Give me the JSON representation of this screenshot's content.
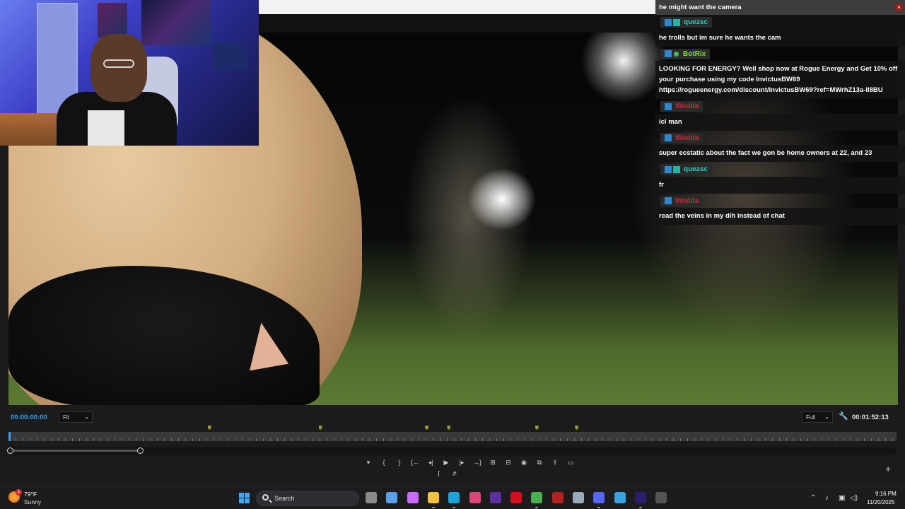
{
  "chat": {
    "top_message": "he might want the camera",
    "close_label": "×",
    "messages": [
      {
        "user": "quezsc",
        "user_color": "#23d3c4",
        "badge": "teal",
        "text": "he trolls but im sure he wants the cam"
      },
      {
        "user": "BotRix",
        "user_color": "#7fe12d",
        "badge": "green",
        "text": "LOOKING FOR ENERGY? Well shop now at Rogue Energy and Get 10% off your purchase using my code InvictusBW69 https://rogueenergy.com/discount/InvictusBW69?ref=MWrhZ13a-Il8BU"
      },
      {
        "user": "Wodda",
        "user_color": "#d0243b",
        "badge": "blue",
        "text": "icl man"
      },
      {
        "user": "Wodda",
        "user_color": "#d0243b",
        "badge": "blue",
        "text": "super ecstatic about the fact we gon be home owners at 22, and 23"
      },
      {
        "user": "quezsc",
        "user_color": "#23d3c4",
        "badge": "teal",
        "text": "fr"
      },
      {
        "user": "Wodda",
        "user_color": "#d0243b",
        "badge": "blue",
        "text": "read the veins in my dih instead of chat"
      }
    ]
  },
  "monitor": {
    "timecode_current": "00:00:00:00",
    "zoom_select": "Fit",
    "quality_select": "Full",
    "timecode_duration": "00:01:52:13",
    "playhead_fraction": 0,
    "chevron": "⌄"
  },
  "transport": {
    "buttons": [
      {
        "name": "add-marker-icon",
        "glyph": "▾"
      },
      {
        "name": "mark-in-icon",
        "glyph": "{"
      },
      {
        "name": "mark-out-icon",
        "glyph": "}"
      },
      {
        "name": "go-to-in-icon",
        "glyph": "{←"
      },
      {
        "name": "step-back-icon",
        "glyph": "◂|"
      },
      {
        "name": "play-icon",
        "glyph": "▶"
      },
      {
        "name": "step-forward-icon",
        "glyph": "|▸"
      },
      {
        "name": "go-to-out-icon",
        "glyph": "→}"
      },
      {
        "name": "lift-icon",
        "glyph": "⊞"
      },
      {
        "name": "extract-icon",
        "glyph": "⊟"
      },
      {
        "name": "export-frame-icon",
        "glyph": "◉"
      },
      {
        "name": "insert-icon",
        "glyph": "⧉"
      },
      {
        "name": "overwrite-icon",
        "glyph": "⇪"
      },
      {
        "name": "safe-margins-icon",
        "glyph": "▭"
      }
    ],
    "secondary": [
      {
        "name": "comparison-view-icon",
        "glyph": "⌈"
      },
      {
        "name": "grid-icon",
        "glyph": "#"
      }
    ],
    "add_button": "+"
  },
  "taskbar": {
    "weather_temp": "79°F",
    "weather_condition": "Sunny",
    "weather_badge": "1",
    "search_label": "Search",
    "apps": [
      {
        "name": "task-view-icon",
        "color": "#8a8a8a"
      },
      {
        "name": "microsoft-store-icon",
        "color": "#5aa0e8"
      },
      {
        "name": "copilot-icon",
        "color": "#c86cff"
      },
      {
        "name": "file-explorer-icon",
        "color": "#f3c23b"
      },
      {
        "name": "edge-icon",
        "color": "#1fa2d8"
      },
      {
        "name": "instagram-icon",
        "color": "#e0457b"
      },
      {
        "name": "nzxt-icon",
        "color": "#5b2fa0"
      },
      {
        "name": "opera-icon",
        "color": "#d3101e"
      },
      {
        "name": "chrome-icon",
        "color": "#4caf50"
      },
      {
        "name": "voicemeeter-icon",
        "color": "#b22222"
      },
      {
        "name": "settings-icon",
        "color": "#9ab"
      },
      {
        "name": "discord-icon",
        "color": "#5865f2"
      },
      {
        "name": "photos-icon",
        "color": "#3aa0e0"
      },
      {
        "name": "premiere-pro-icon",
        "color": "#2a1f6e"
      },
      {
        "name": "obs-icon",
        "color": "#555"
      }
    ],
    "tray": {
      "chevron": "⌃",
      "mic": "♪",
      "display": "▣",
      "volume": "◁)"
    },
    "time": "9:16 PM",
    "date": "11/20/2025"
  },
  "markers": [
    0.226,
    0.351,
    0.471,
    0.496,
    0.595,
    0.64
  ]
}
